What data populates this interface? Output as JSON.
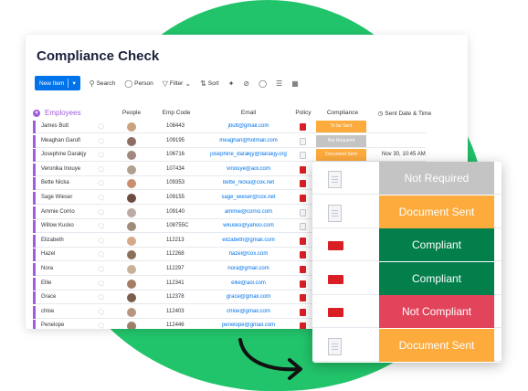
{
  "page": {
    "title": "Compliance Check"
  },
  "toolbar": {
    "new_item": "New Item",
    "search": "Search",
    "person": "Person",
    "filter": "Filter",
    "sort": "Sort"
  },
  "group": {
    "title": "Employees"
  },
  "columns": {
    "people": "People",
    "emp_code": "Emp Code",
    "email": "Email",
    "policy": "Policy",
    "compliance": "Compliance",
    "sent_date": "Sent Date & Time"
  },
  "status_colors": {
    "To be Sent": "#fdab3d",
    "Not Required": "#c4c4c4",
    "Document Sent": "#fdab3d",
    "Compliant": "#037f4c",
    "Not Compliant": "#e2445c"
  },
  "rows": [
    {
      "name": "James Butt",
      "code": "108443",
      "email": "jbutt@gmail.com",
      "policy": "pdf",
      "compliance": "To be Sent",
      "date": "",
      "avatar": "#c9a27e"
    },
    {
      "name": "Meaghan Garufi",
      "code": "109195",
      "email": "meaghan@hotmail.com",
      "policy": "doc",
      "compliance": "Not Required",
      "date": "",
      "avatar": "#8d6e63"
    },
    {
      "name": "Josephine Darakjy",
      "code": "106716",
      "email": "josephine_darakjy@darakjy.org",
      "policy": "doc",
      "compliance": "Document Sent",
      "date": "Nov 30, 10:45 AM",
      "avatar": "#a1887f"
    },
    {
      "name": "Veronika Inouye",
      "code": "107434",
      "email": "vinouye@aol.com",
      "policy": "pdf",
      "compliance": "",
      "date": "",
      "avatar": "#b0a090"
    },
    {
      "name": "Bette Nicka",
      "code": "109353",
      "email": "bette_nicka@cox.net",
      "policy": "pdf",
      "compliance": "",
      "date": "",
      "avatar": "#c98e6e"
    },
    {
      "name": "Sage Wieser",
      "code": "109155",
      "email": "sage_wieser@cox.net",
      "policy": "pdf",
      "compliance": "",
      "date": "",
      "avatar": "#6d4c41"
    },
    {
      "name": "Ammie Corrio",
      "code": "109140",
      "email": "ammie@corrio.com",
      "policy": "doc",
      "compliance": "",
      "date": "",
      "avatar": "#bcaaa4"
    },
    {
      "name": "Willow Kusko",
      "code": "108755C",
      "email": "wkusko@yahoo.com",
      "policy": "doc",
      "compliance": "",
      "date": "",
      "avatar": "#9e8b7a"
    },
    {
      "name": "Elizabeth",
      "code": "112213",
      "email": "elizabeth@gmail.com",
      "policy": "pdf",
      "compliance": "",
      "date": "",
      "avatar": "#d7a98a"
    },
    {
      "name": "Hazel",
      "code": "112268",
      "email": "hazel@cox.com",
      "policy": "pdf",
      "compliance": "",
      "date": "",
      "avatar": "#8a6f5c"
    },
    {
      "name": "Nora",
      "code": "112297",
      "email": "nora@gmail.com",
      "policy": "pdf",
      "compliance": "",
      "date": "",
      "avatar": "#c7b299"
    },
    {
      "name": "Ellie",
      "code": "112341",
      "email": "ellie@aol.com",
      "policy": "pdf",
      "compliance": "",
      "date": "",
      "avatar": "#a57c65"
    },
    {
      "name": "Grace",
      "code": "112378",
      "email": "grace@gmail.com",
      "policy": "pdf",
      "compliance": "",
      "date": "",
      "avatar": "#7b5e4e"
    },
    {
      "name": "chloe",
      "code": "112403",
      "email": "chloe@gmail.com",
      "policy": "pdf",
      "compliance": "",
      "date": "",
      "avatar": "#b89580"
    },
    {
      "name": "Penelope",
      "code": "112446",
      "email": "penelope@gmail.com",
      "policy": "pdf",
      "compliance": "",
      "date": "",
      "avatar": "#9d7f6b"
    }
  ],
  "popup": [
    {
      "policy": "doc",
      "label": "Not Required",
      "color": "#c4c4c4"
    },
    {
      "policy": "doc",
      "label": "Document Sent",
      "color": "#fdab3d"
    },
    {
      "policy": "pdf",
      "label": "Compliant",
      "color": "#037f4c"
    },
    {
      "policy": "pdf",
      "label": "Compliant",
      "color": "#037f4c"
    },
    {
      "policy": "pdf",
      "label": "Not Compliant",
      "color": "#e2445c"
    },
    {
      "policy": "doc",
      "label": "Document Sent",
      "color": "#fdab3d"
    }
  ]
}
